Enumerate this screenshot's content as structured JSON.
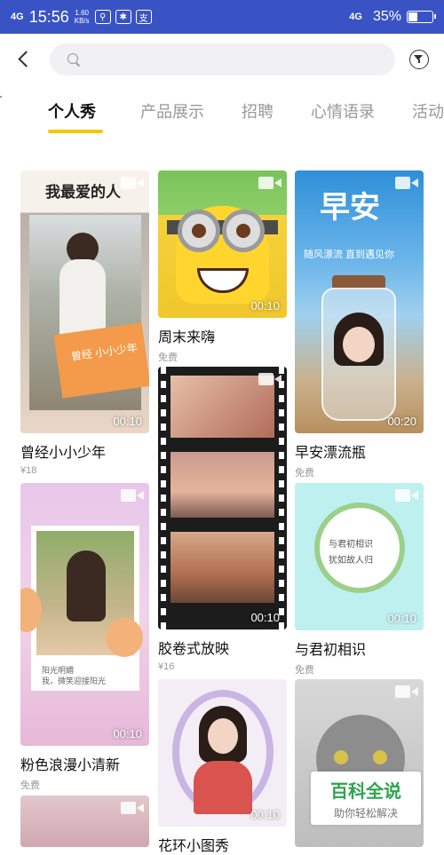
{
  "status_bar": {
    "network": "4G",
    "time": "15:56",
    "speed_value": "1.60",
    "speed_unit": "KB/s",
    "network_right": "4G",
    "battery": "35%",
    "battery_level": 0.35
  },
  "search": {
    "placeholder": "",
    "value": ""
  },
  "tabs": [
    {
      "label": "个人秀"
    },
    {
      "label": "产品展示"
    },
    {
      "label": "招聘"
    },
    {
      "label": "心情语录"
    },
    {
      "label": "活动"
    }
  ],
  "cards": [
    {
      "title": "曾经小小少年",
      "price": "¥18",
      "duration": "00:10",
      "overlay_top": "我最爱的人",
      "overlay_note": "曾经 小小少年"
    },
    {
      "title": "周末来嗨",
      "price": "免费",
      "duration": "00:10"
    },
    {
      "title": "早安漂流瓶",
      "price": "免费",
      "duration": "00:20",
      "overlay_top": "早安",
      "overlay_sub": "随风漂流 直到遇见你"
    },
    {
      "title": "胶卷式放映",
      "price": "¥16",
      "duration": "00:10"
    },
    {
      "title": "与君初相识",
      "price": "免费",
      "duration": "00:10",
      "overlay_line1": "与君初相识",
      "overlay_line2": "犹如故人归"
    },
    {
      "title": "粉色浪漫小清新",
      "price": "免费",
      "duration": "00:10",
      "overlay_line1": "阳光明媚",
      "overlay_line2": "我，微笑迎接阳光"
    },
    {
      "title": "花环小图秀",
      "duration": "00:10"
    },
    {
      "title": ""
    },
    {
      "title": ""
    }
  ],
  "watermark": {
    "main": "百科全说",
    "sub": "助你轻松解决"
  },
  "colors": {
    "status_bar": "#3a53c4",
    "tab_indicator": "#f5c800"
  }
}
